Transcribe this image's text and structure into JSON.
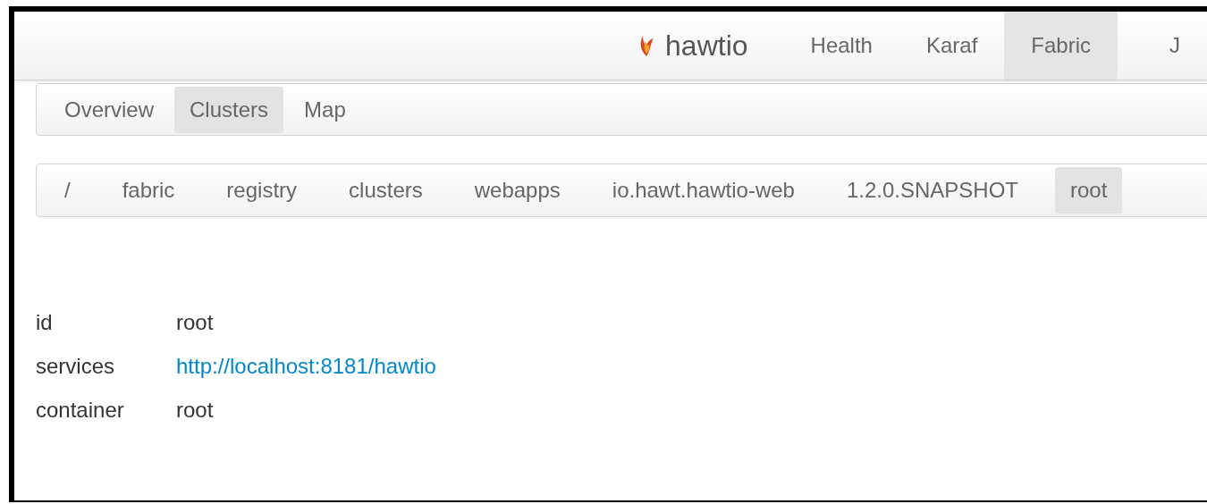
{
  "navbar": {
    "brand": "hawtio",
    "items": [
      {
        "label": "Health",
        "selected": false
      },
      {
        "label": "Karaf",
        "selected": false
      },
      {
        "label": "Fabric",
        "selected": true
      },
      {
        "label": "J",
        "selected": false
      }
    ]
  },
  "subnav": [
    {
      "label": "Overview",
      "selected": false
    },
    {
      "label": "Clusters",
      "selected": true
    },
    {
      "label": "Map",
      "selected": false
    }
  ],
  "breadcrumbs": [
    {
      "label": "/",
      "selected": false
    },
    {
      "label": "fabric",
      "selected": false
    },
    {
      "label": "registry",
      "selected": false
    },
    {
      "label": "clusters",
      "selected": false
    },
    {
      "label": "webapps",
      "selected": false
    },
    {
      "label": "io.hawt.hawtio-web",
      "selected": false
    },
    {
      "label": "1.2.0.SNAPSHOT",
      "selected": false
    },
    {
      "label": "root",
      "selected": true
    }
  ],
  "details": [
    {
      "label": "id",
      "value": "root",
      "kind": "text"
    },
    {
      "label": "services",
      "value": "http://localhost:8181/hawtio",
      "kind": "link"
    },
    {
      "label": "container",
      "value": "root",
      "kind": "text"
    }
  ]
}
